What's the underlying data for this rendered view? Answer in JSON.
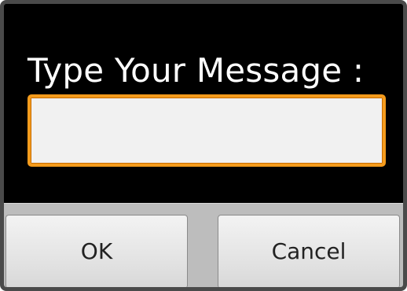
{
  "dialog": {
    "title": "Type Your Message :",
    "message_input": {
      "value": "",
      "placeholder": ""
    },
    "buttons": {
      "ok_label": "OK",
      "cancel_label": "Cancel"
    }
  },
  "colors": {
    "dialog_background": "#000000",
    "input_border": "#f49b1c",
    "button_bar": "#bdbdbd"
  }
}
